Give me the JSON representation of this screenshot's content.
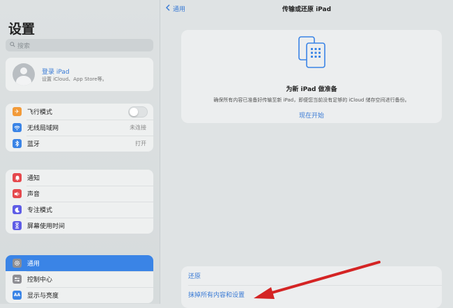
{
  "sidebar": {
    "title": "设置",
    "search_placeholder": "搜索",
    "profile": {
      "name": "登录 iPad",
      "subtitle": "设置 iCloud、App Store等。"
    },
    "group1": [
      {
        "label": "飞行模式",
        "icon": "airplane-icon",
        "color": "#f29a38",
        "control": "toggle",
        "toggle_on": false
      },
      {
        "label": "无线局域网",
        "icon": "wifi-icon",
        "color": "#3a84e6",
        "value": "未连接"
      },
      {
        "label": "蓝牙",
        "icon": "bluetooth-icon",
        "color": "#3a84e6",
        "value": "打开"
      }
    ],
    "group2": [
      {
        "label": "通知",
        "icon": "bell-icon",
        "color": "#e5484d"
      },
      {
        "label": "声音",
        "icon": "speaker-icon",
        "color": "#e5484d"
      },
      {
        "label": "专注模式",
        "icon": "moon-icon",
        "color": "#5e5ce6"
      },
      {
        "label": "屏幕使用时间",
        "icon": "hourglass-icon",
        "color": "#5e5ce6"
      }
    ],
    "group3": [
      {
        "label": "通用",
        "icon": "gear-icon",
        "color": "#8e8e93",
        "selected": true
      },
      {
        "label": "控制中心",
        "icon": "control-center-icon",
        "color": "#8e8e93"
      },
      {
        "label": "显示与亮度",
        "icon": "display-icon",
        "color": "#3a84e6",
        "glyph": "AA"
      }
    ]
  },
  "header": {
    "back_label": "通用",
    "title": "传输或还原 iPad"
  },
  "prepare": {
    "heading": "为新 iPad 做准备",
    "description": "确保所有内容已准备好传输至新 iPad，即便您当前没有足够的 iCloud 储存空间进行备份。",
    "action": "现在开始"
  },
  "bottom": {
    "reset_label": "还原",
    "erase_label": "抹掉所有内容和设置"
  },
  "annotation": {
    "arrow_color": "#d42424"
  }
}
